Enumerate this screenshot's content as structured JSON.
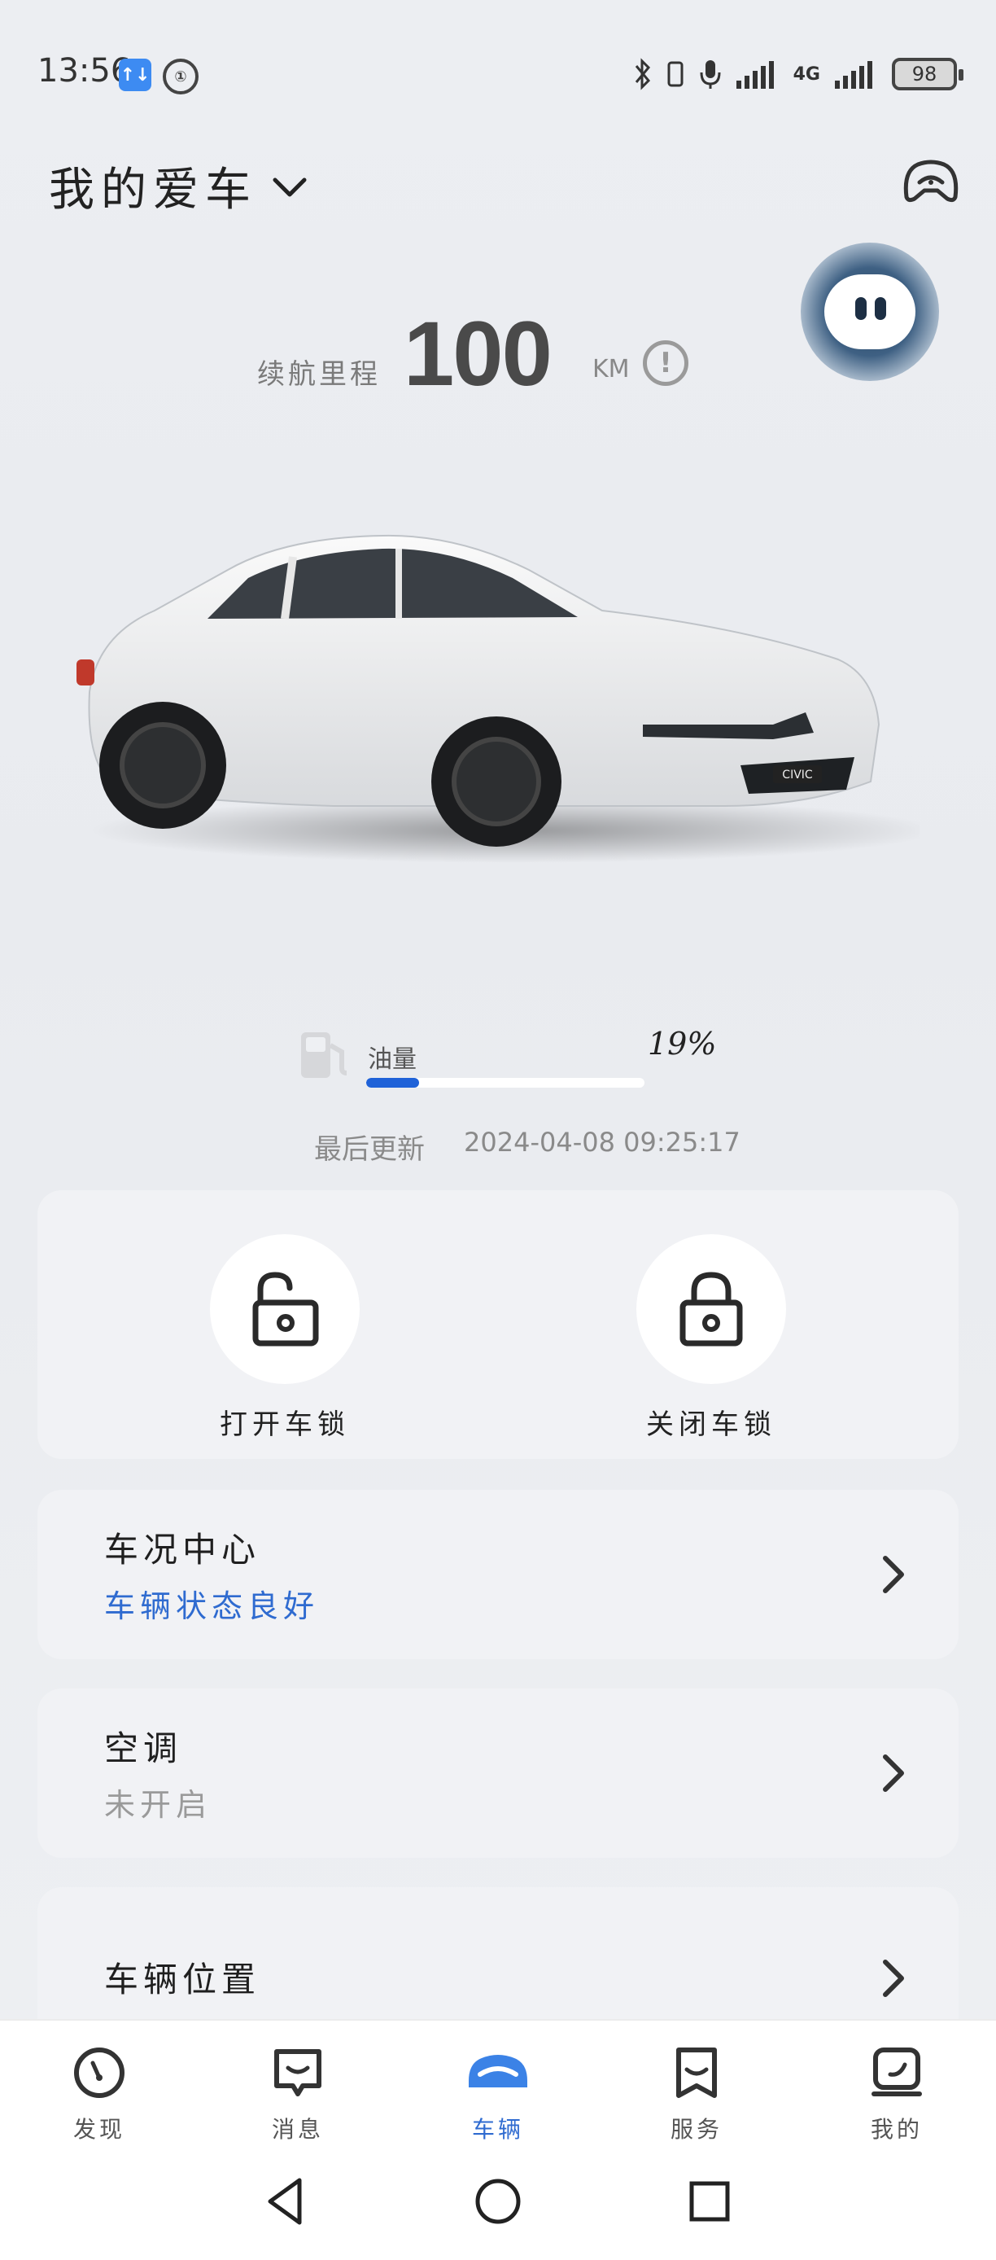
{
  "status_bar": {
    "time": "13:56",
    "app_badge_1": "↑↓",
    "app_badge_2": "①",
    "network": "4G",
    "battery": "98"
  },
  "header": {
    "title": "我的爱车"
  },
  "range": {
    "label": "续航里程",
    "value": "100",
    "unit": "KM",
    "info_symbol": "!"
  },
  "fuel": {
    "label": "油量",
    "percent_text": "19%",
    "level": 0.19
  },
  "update": {
    "label": "最后更新",
    "timestamp": "2024-04-08 09:25:17"
  },
  "locks": {
    "unlock_label": "打开车锁",
    "lock_label": "关闭车锁"
  },
  "rows": [
    {
      "title": "车况中心",
      "subtitle": "车辆状态良好"
    },
    {
      "title": "空调",
      "subtitle": "未开启"
    },
    {
      "title": "车辆位置"
    }
  ],
  "tabs": [
    {
      "label": "发现",
      "icon": "compass-icon"
    },
    {
      "label": "消息",
      "icon": "message-icon"
    },
    {
      "label": "车辆",
      "icon": "car-icon"
    },
    {
      "label": "服务",
      "icon": "service-icon"
    },
    {
      "label": "我的",
      "icon": "profile-icon"
    }
  ],
  "colors": {
    "accent": "#2f6bd0",
    "fuel_bar": "#1f62d8",
    "card_bg": "#f1f2f5"
  }
}
